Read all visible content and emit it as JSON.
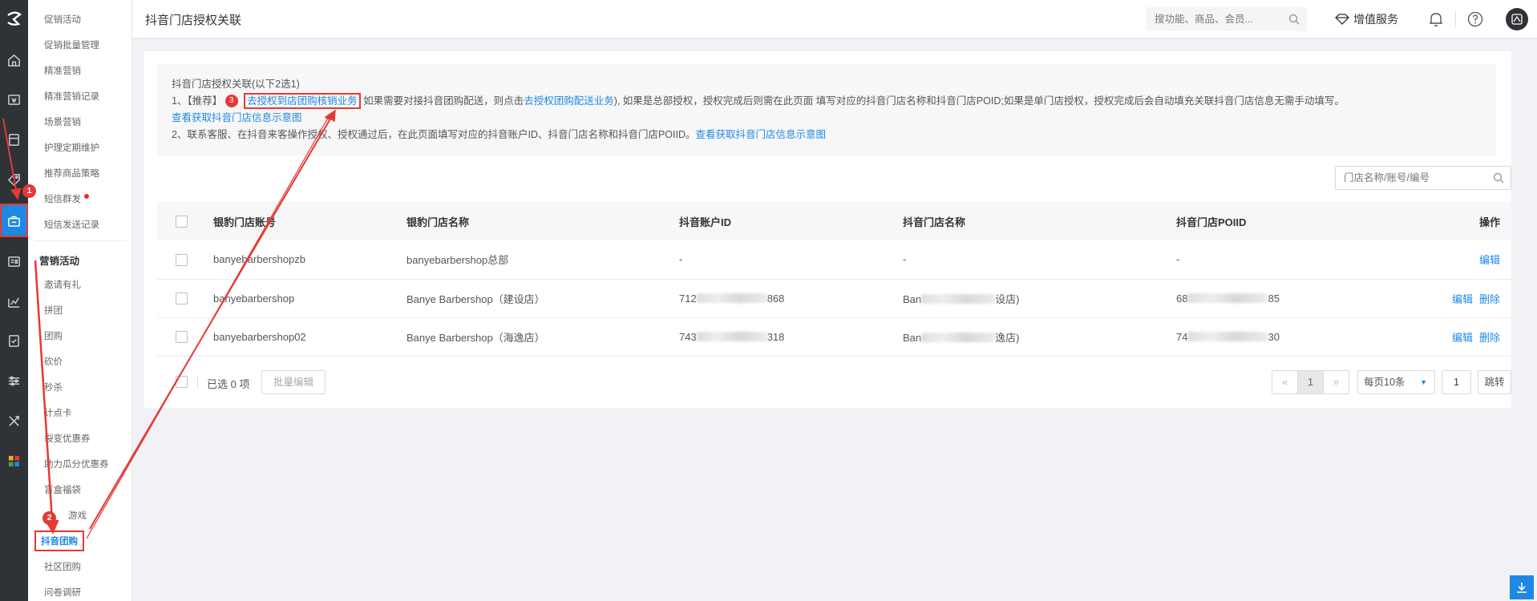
{
  "header": {
    "title": "抖音门店授权关联",
    "search_placeholder": "搜功能、商品、会员...",
    "vas_label": "增值服务"
  },
  "rail": {
    "icons": [
      "logo",
      "home-icon",
      "cash-icon",
      "card-icon",
      "tag-icon",
      "marketing-icon",
      "id-card-icon",
      "chart-icon",
      "report-icon",
      "settings-icon",
      "tools-icon",
      "apps-icon"
    ]
  },
  "menu": {
    "items_top": [
      "促销活动",
      "促销批量管理",
      "精准营销",
      "精准营销记录",
      "场景营销",
      "护理定期维护",
      "推荐商品策略",
      "短信群发",
      "短信发送记录"
    ],
    "section_title": "营销活动",
    "items_bottom": [
      "邀请有礼",
      "拼团",
      "团购",
      "砍价",
      "秒杀",
      "计点卡",
      "裂变优惠券",
      "助力瓜分优惠券",
      "盲盒福袋",
      "游戏",
      "抖音团购",
      "社区团购",
      "问卷调研"
    ]
  },
  "notice": {
    "line1": "抖音门店授权关联(以下2选1)",
    "line2_prefix": "1、【推荐】",
    "line2_link1": "去授权到店团购核销业务",
    "line2_mid": "如果需要对接抖音团购配送，则点击",
    "line2_link2": "去授权团购配送业务",
    "line2_suffix": "), 如果是总部授权，授权完成后则需在此页面 填写对应的抖音门店名称和抖音门店POID;如果是单门店授权，授权完成后会自动填充关联抖音门店信息无需手动填写。",
    "line3_link": "查看获取抖音门店信息示意图",
    "line4_text": "2、联系客服、在抖音来客操作授权、授权通过后，在此页面填写对应的抖音账户ID、抖音门店名称和抖音门店POIID。",
    "line4_link": "查看获取抖音门店信息示意图"
  },
  "table_search_placeholder": "门店名称/账号/编号",
  "table": {
    "headers": [
      "银豹门店账号",
      "银豹门店名称",
      "抖音账户ID",
      "抖音门店名称",
      "抖音门店POIID",
      "操作"
    ],
    "rows": [
      {
        "account": "banyebarbershopzb",
        "name": "banyebarbershop总部",
        "dy_id": "-",
        "dy_name": "-",
        "poi": "-",
        "actions": [
          "编辑"
        ]
      },
      {
        "account": "banyebarbershop",
        "name": "Banye Barbershop（建设店）",
        "dy_id_start": "712",
        "dy_id_end": "868",
        "dy_name_start": "Ban",
        "dy_name_end": "设店)",
        "poi_start": "68",
        "poi_end": "85",
        "actions": [
          "编辑",
          "删除"
        ]
      },
      {
        "account": "banyebarbershop02",
        "name": "Banye Barbershop（海逸店）",
        "dy_id_start": "743",
        "dy_id_end": "318",
        "dy_name_start": "Ban",
        "dy_name_end": "逸店)",
        "poi_start": "74",
        "poi_end": "30",
        "actions": [
          "编辑",
          "删除"
        ]
      }
    ]
  },
  "footer": {
    "selected_label": "已选 0 项",
    "batch_edit": "批量编辑",
    "prev": "«",
    "page": "1",
    "next": "»",
    "page_size": "每页10条",
    "jump_value": "1",
    "jump_label": "跳转"
  },
  "annotations": {
    "badge1": "1",
    "badge2": "2",
    "badge3": "3"
  },
  "colors": {
    "accent": "#1e88e5",
    "annotation": "#e53935",
    "rail": "#2f3236"
  }
}
